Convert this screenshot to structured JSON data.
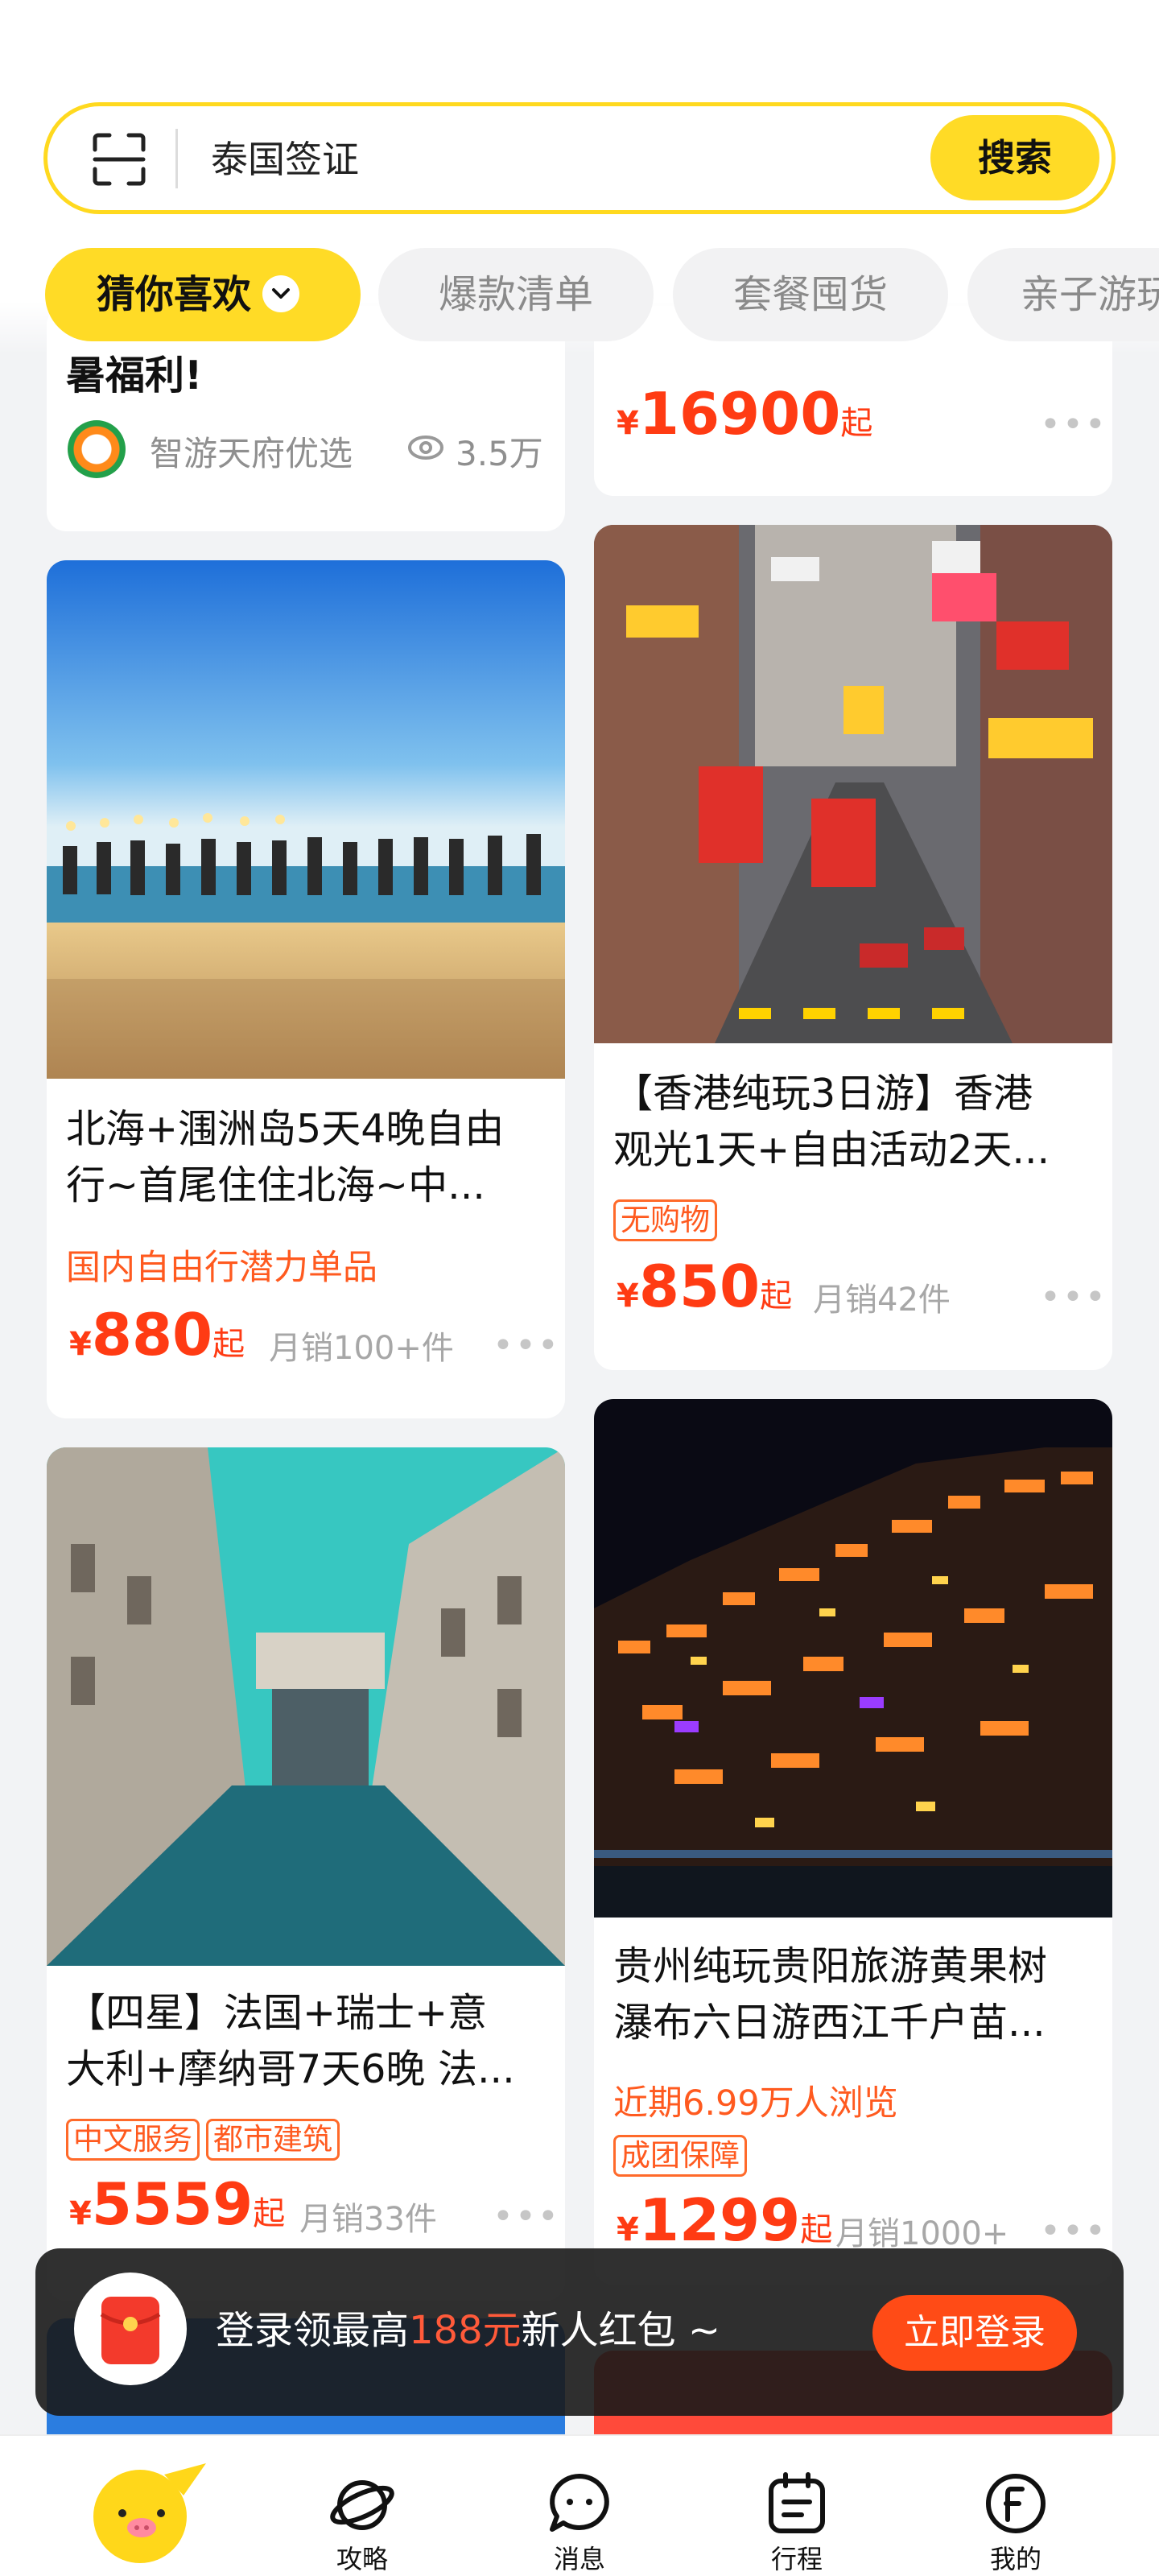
{
  "search": {
    "query": "泰国签证",
    "button": "搜索"
  },
  "tabs": [
    {
      "label": "猜你喜欢",
      "active": true
    },
    {
      "label": "爆款清单"
    },
    {
      "label": "套餐囤货"
    },
    {
      "label": "亲子游玩"
    }
  ],
  "cards": [
    {
      "title_tail": "暑福利!",
      "author": "智游天府优选",
      "views": "3.5万"
    },
    {
      "price": {
        "yen": "¥",
        "amount": "16900",
        "suffix": "起"
      },
      "more": "•••"
    },
    {
      "title_lines": [
        "北海+涠洲岛5天4晚自由",
        "行~首尾住住北海~中..."
      ],
      "highlight": "国内自由行潜力单品",
      "price": {
        "yen": "¥",
        "amount": "880",
        "suffix": "起"
      },
      "sales": "月销100+件",
      "more": "•••"
    },
    {
      "title_lines": [
        "【香港纯玩3日游】香港",
        "观光1天+自由活动2天..."
      ],
      "tags": [
        "无购物"
      ],
      "price": {
        "yen": "¥",
        "amount": "850",
        "suffix": "起"
      },
      "sales": "月销42件",
      "more": "•••"
    },
    {
      "title_lines": [
        "【四星】法国+瑞士+意",
        "大利+摩纳哥7天6晚 法..."
      ],
      "tags": [
        "中文服务",
        "都市建筑"
      ],
      "price": {
        "yen": "¥",
        "amount": "5559",
        "suffix": "起"
      },
      "sales": "月销33件",
      "more": "•••"
    },
    {
      "title_lines": [
        "贵州纯玩贵阳旅游黄果树",
        "瀑布六日游西江千户苗..."
      ],
      "highlight": "近期6.99万人浏览",
      "tags": [
        "成团保障"
      ],
      "price": {
        "yen": "¥",
        "amount": "1299",
        "suffix": "起"
      },
      "sales": "月销1000+",
      "more": "•••"
    }
  ],
  "toast": {
    "text_before": "登录领最高",
    "amount": "188元",
    "text_after": "新人红包 ~",
    "button": "立即登录"
  },
  "bottom_nav": [
    {
      "label": "",
      "icon": "home-pig-icon"
    },
    {
      "label": "攻略",
      "icon": "planet-icon"
    },
    {
      "label": "消息",
      "icon": "chat-icon"
    },
    {
      "label": "行程",
      "icon": "calendar-icon"
    },
    {
      "label": "我的",
      "icon": "profile-f-icon"
    }
  ],
  "colors": {
    "brand_yellow": "#ffdb26",
    "price_red": "#ff3b13",
    "accent_orange": "#ff5a1f"
  }
}
